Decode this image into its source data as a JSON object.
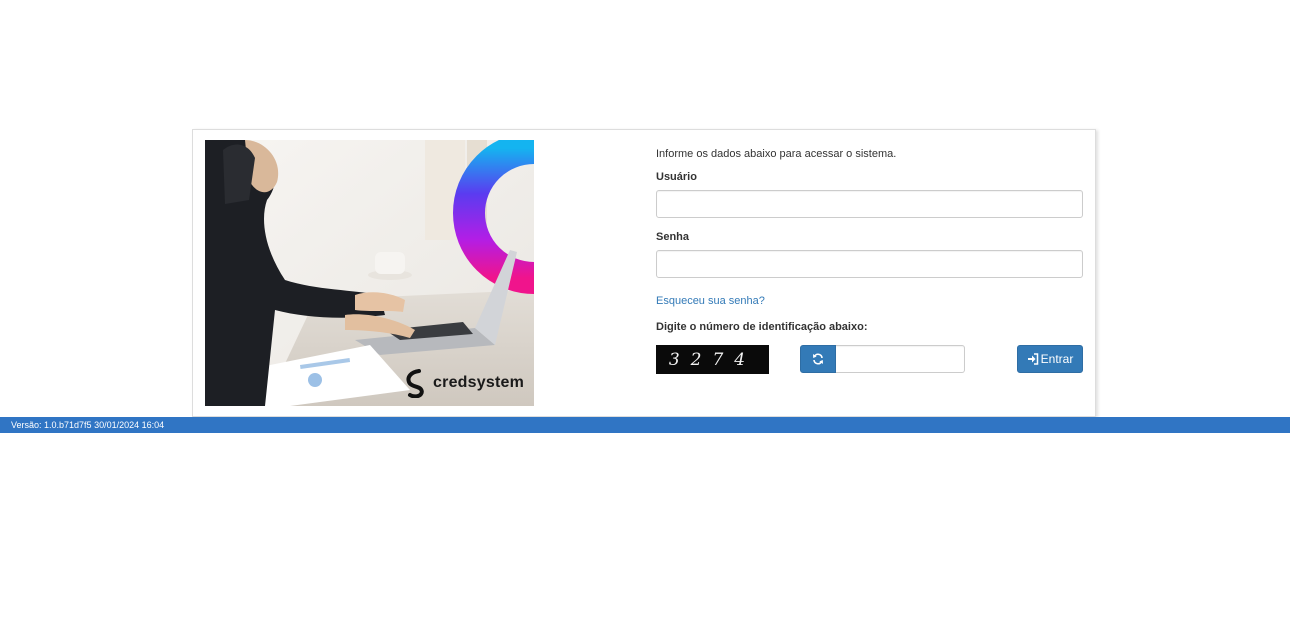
{
  "brand": {
    "logo_text": "credsystem"
  },
  "login": {
    "intro": "Informe os dados abaixo para acessar o sistema.",
    "user_label": "Usuário",
    "user_value": "",
    "password_label": "Senha",
    "password_value": "",
    "forgot_link": "Esqueceu sua senha?",
    "captcha_label": "Digite o número de identificação abaixo:",
    "captcha_code": "3274",
    "captcha_value": "",
    "submit_label": "Entrar",
    "submit_icon": "sign-in-icon",
    "refresh_icon": "refresh-icon"
  },
  "footer": {
    "version": "Versão: 1.0.b71d7f5 30/01/2024 16:04"
  },
  "colors": {
    "primary": "#337ab7",
    "footer_bar": "#3075c4",
    "link": "#337ab7"
  }
}
